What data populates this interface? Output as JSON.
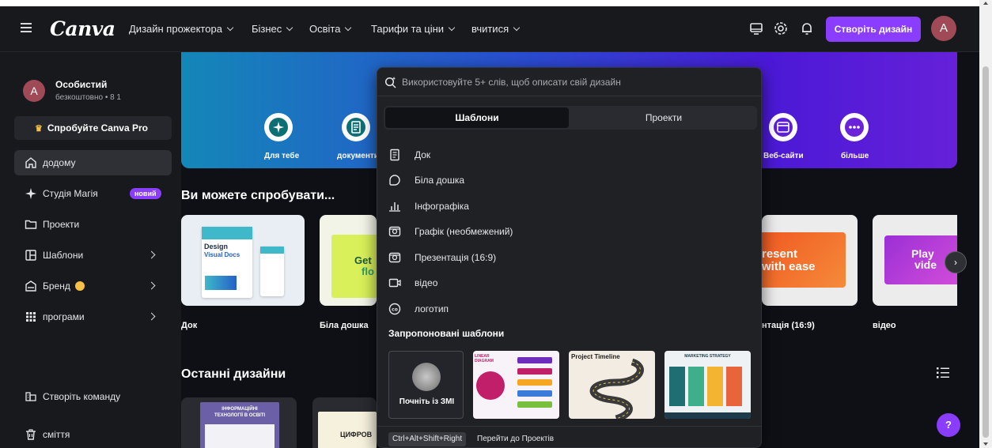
{
  "topbar": {
    "logo": "Canva",
    "nav": [
      {
        "label": "Дизайн прожектора"
      },
      {
        "label": "Бізнес"
      },
      {
        "label": "Освіта"
      },
      {
        "label": "Тарифи та ціни"
      },
      {
        "label": "вчитися"
      }
    ],
    "create_button": "Створіть дизайн",
    "avatar_letter": "A"
  },
  "sidebar": {
    "account": {
      "avatar_letter": "A",
      "name": "Особистий",
      "plan": "безкоштовно • 8 1"
    },
    "try_pro": "Спробуйте Canva Pro",
    "items": [
      {
        "label": "додому",
        "icon": "home-icon"
      },
      {
        "label": "Студія Магія",
        "icon": "magic-sparkle-icon",
        "badge": "новий"
      },
      {
        "label": "Проекти",
        "icon": "folder-icon"
      },
      {
        "label": "Шаблони",
        "icon": "templates-icon"
      },
      {
        "label": "Бренд",
        "icon": "brand-icon"
      },
      {
        "label": "програми",
        "icon": "apps-grid-icon"
      }
    ],
    "bottom_items": [
      {
        "label": "Створіть команду",
        "icon": "team-icon"
      },
      {
        "label": "сміття",
        "icon": "trash-icon"
      }
    ]
  },
  "hero": {
    "buttons": [
      {
        "label": "Для тебе",
        "icon": "sparkle-icon"
      },
      {
        "label": "документи",
        "icon": "doc-icon"
      },
      {
        "label": "Веб-сайти",
        "icon": "website-icon"
      },
      {
        "label": "більше",
        "icon": "more-icon"
      }
    ]
  },
  "main": {
    "try_title": "Ви можете спробувати...",
    "try_cards": [
      {
        "label": "Док",
        "art_line1": "Design",
        "art_line2": "Visual Docs"
      },
      {
        "label": "Біла дошка",
        "art_line1": "Get",
        "art_line2": "flo"
      },
      {
        "label": "нтація (16:9)",
        "art_line1": "resent",
        "art_line2": "with ease"
      },
      {
        "label": "відео",
        "art_line1": "Play",
        "art_line2": "vide"
      }
    ],
    "recent_title": "Останні дизайни",
    "recent_cards": [
      {
        "art_line1": "ІНФОРМАЦІЙНІ",
        "art_line2": "ТЕХНОЛОГІЇ В ОСВІТІ"
      },
      {
        "art_line1": "ЦИФРОВ"
      }
    ]
  },
  "dropdown": {
    "search_placeholder": "Використовуйте 5+ слів, щоб описати свій дизайн",
    "tabs": [
      {
        "label": "Шаблони",
        "active": true
      },
      {
        "label": "Проекти",
        "active": false
      }
    ],
    "items": [
      {
        "label": "Док",
        "icon": "doc-icon"
      },
      {
        "label": "Біла дошка",
        "icon": "whiteboard-icon"
      },
      {
        "label": "Інфографіка",
        "icon": "infographic-icon"
      },
      {
        "label": "Графік (необмежений)",
        "icon": "graphic-icon"
      },
      {
        "label": "Презентація (16:9)",
        "icon": "presentation-icon"
      },
      {
        "label": "відео",
        "icon": "video-icon"
      },
      {
        "label": "логотип",
        "icon": "logo-icon"
      }
    ],
    "suggested_title": "Запропоновані шаблони",
    "templates": [
      {
        "label": "Почніть із ЗМІ"
      },
      {
        "title": "LINEAR DIAGRAM"
      },
      {
        "title": "Project Timeline"
      },
      {
        "title": "MARKETING STRATEGY"
      }
    ],
    "shortcut": "Ctrl+Alt+Shift+Right",
    "shortcut_label": "Перейти до Проектів"
  },
  "help_button": "?",
  "colors": {
    "accent": "#8b3dff",
    "sidebar_bg": "#18191d",
    "page_bg": "#0f1015",
    "avatar": "#a04a57"
  }
}
